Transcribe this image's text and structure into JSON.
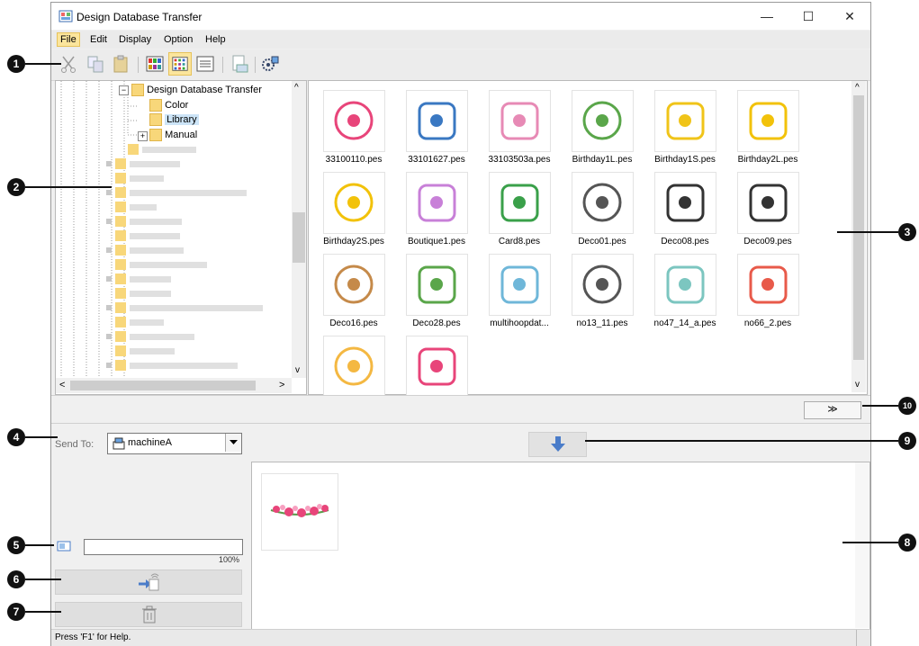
{
  "window": {
    "title": "Design Database Transfer",
    "minimize": "—",
    "maximize": "☐",
    "close": "✕"
  },
  "menu": [
    "File",
    "Edit",
    "Display",
    "Option",
    "Help"
  ],
  "tree": {
    "root": "Design Database Transfer",
    "children": [
      "Color",
      "Library",
      "Manual"
    ],
    "selected": "Library",
    "expand_minus": "−",
    "expand_plus": "+"
  },
  "thumbnails": [
    "33100110.pes",
    "33101627.pes",
    "33103503a.pes",
    "Birthday1L.pes",
    "Birthday1S.pes",
    "Birthday2L.pes",
    "Birthday2S.pes",
    "Boutique1.pes",
    "Card8.pes",
    "Deco01.pes",
    "Deco08.pes",
    "Deco09.pes",
    "Deco16.pes",
    "Deco28.pes",
    "multihoopdat...",
    "no13_11.pes",
    "no47_14_a.pes",
    "no66_2.pes",
    "",
    ""
  ],
  "send_to": {
    "label": "Send To:",
    "value": "machineA"
  },
  "progress": {
    "percent_label": "100%",
    "value": 0
  },
  "status": {
    "text": "Press 'F1' for Help."
  },
  "expand_button": "≫",
  "callouts": [
    "1",
    "2",
    "3",
    "4",
    "5",
    "6",
    "7",
    "8",
    "9",
    "10"
  ],
  "scroll": {
    "up": "^",
    "down": "v",
    "left": "<",
    "right": ">"
  }
}
